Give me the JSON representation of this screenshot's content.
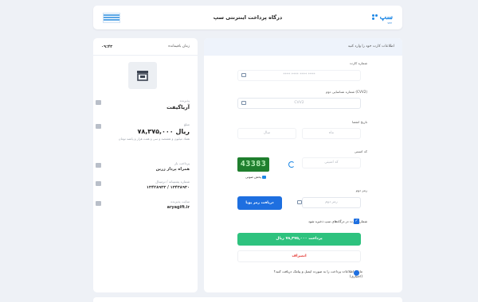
{
  "header": {
    "title": "درگاه پرداخت اینترنتی سپ",
    "logo_text": "سپ",
    "logo_subtext": "SEP"
  },
  "sidebar": {
    "timer_label": "زمان باقیمانده",
    "timer_value": "۰۹:۴۳",
    "merchant_label": "پذیرنده",
    "merchant_name": "آریاگیفت",
    "amount_label": "مبلغ",
    "amount_value": "۷۸,۳۷۵,۰۰۰ ریال",
    "amount_note": "هفتاد میلیون و هشتصد و سی و هفت هزار و پانصد تومان",
    "payer_label": "پرداخت یار",
    "payer_value": "همراه پرداز زرین",
    "terminal_label": "شماره پشتیبانه / ترمینال",
    "terminal_value": "۱۳۴۲۸۹۳۳ / ۱۳۴۳۸۹۳۰",
    "site_label": "سایت پذیرنده",
    "site_value": "aryagift.ir"
  },
  "form": {
    "heading": "اطلاعات کارت خود را وارد کنید",
    "card_label": "شماره کارت",
    "card_placeholder": "**** **** **** ****",
    "cvv_label": "شماره شناسایی دوم (CVV2)",
    "cvv_placeholder": "CVV2",
    "expiry_label": "تاریخ انقضا",
    "month_placeholder": "ماه",
    "year_placeholder": "سال",
    "captcha_label": "کد امنیتی",
    "captcha_placeholder": "کد امنیتی",
    "captcha_text": "43383",
    "audio_label": "پخش صوتی",
    "otp_label": "رمز دوم",
    "otp_placeholder": "رمز دوم",
    "otp_button": "دریافت رمز پویا",
    "save_card_label": "شماره کارت در درگاه‌های سپ ذخیره شود",
    "pay_button": "پرداخت ۷۸,۳۷۵,۰۰۰ ریال",
    "cancel_button": "انصراف",
    "email_question": "مایلید اطلاعات پرداخت را به صورت ایمیل و پیامک دریافت کنید؟ (اختیاری)"
  },
  "colors": {
    "accent": "#1e6fe0",
    "pay": "#2ec27e",
    "cancel": "#e53935",
    "captcha_bg": "#1f7f2e"
  }
}
